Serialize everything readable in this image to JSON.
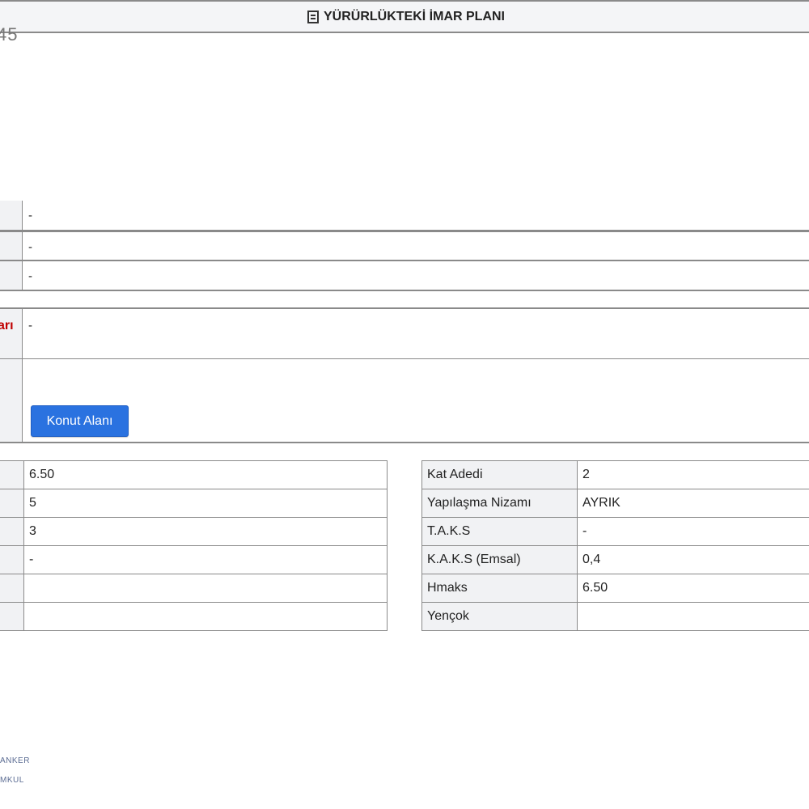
{
  "corner_number": "45",
  "section": {
    "title": "YÜRÜRLÜKTEKİ İMAR PLANI",
    "title_icon": "document-icon",
    "rows": [
      {
        "value": "-"
      },
      {
        "value": "-"
      },
      {
        "value": "-"
      }
    ],
    "notes_label_partial": "arı",
    "notes_value": "-",
    "zone_button": "Konut Alanı"
  },
  "left_table": {
    "values": [
      "6.50",
      "5",
      "3",
      "-",
      "",
      ""
    ]
  },
  "right_table": {
    "rows": [
      {
        "label": "Kat Adedi",
        "value": "2"
      },
      {
        "label": "Yapılaşma Nizamı",
        "value": "AYRIK"
      },
      {
        "label": "T.A.K.S",
        "value": "-"
      },
      {
        "label": "K.A.K.S (Emsal)",
        "value": "0,4"
      },
      {
        "label": "Hmaks",
        "value": "6.50"
      },
      {
        "label": "Yençok",
        "value": ""
      }
    ]
  },
  "watermark": {
    "line1": "ANKER",
    "line2": "MKUL"
  },
  "colors": {
    "accent_button": "#2a72e0",
    "label_red": "#c00000",
    "cell_bg": "#f1f2f4",
    "border": "#8a8a8a"
  }
}
